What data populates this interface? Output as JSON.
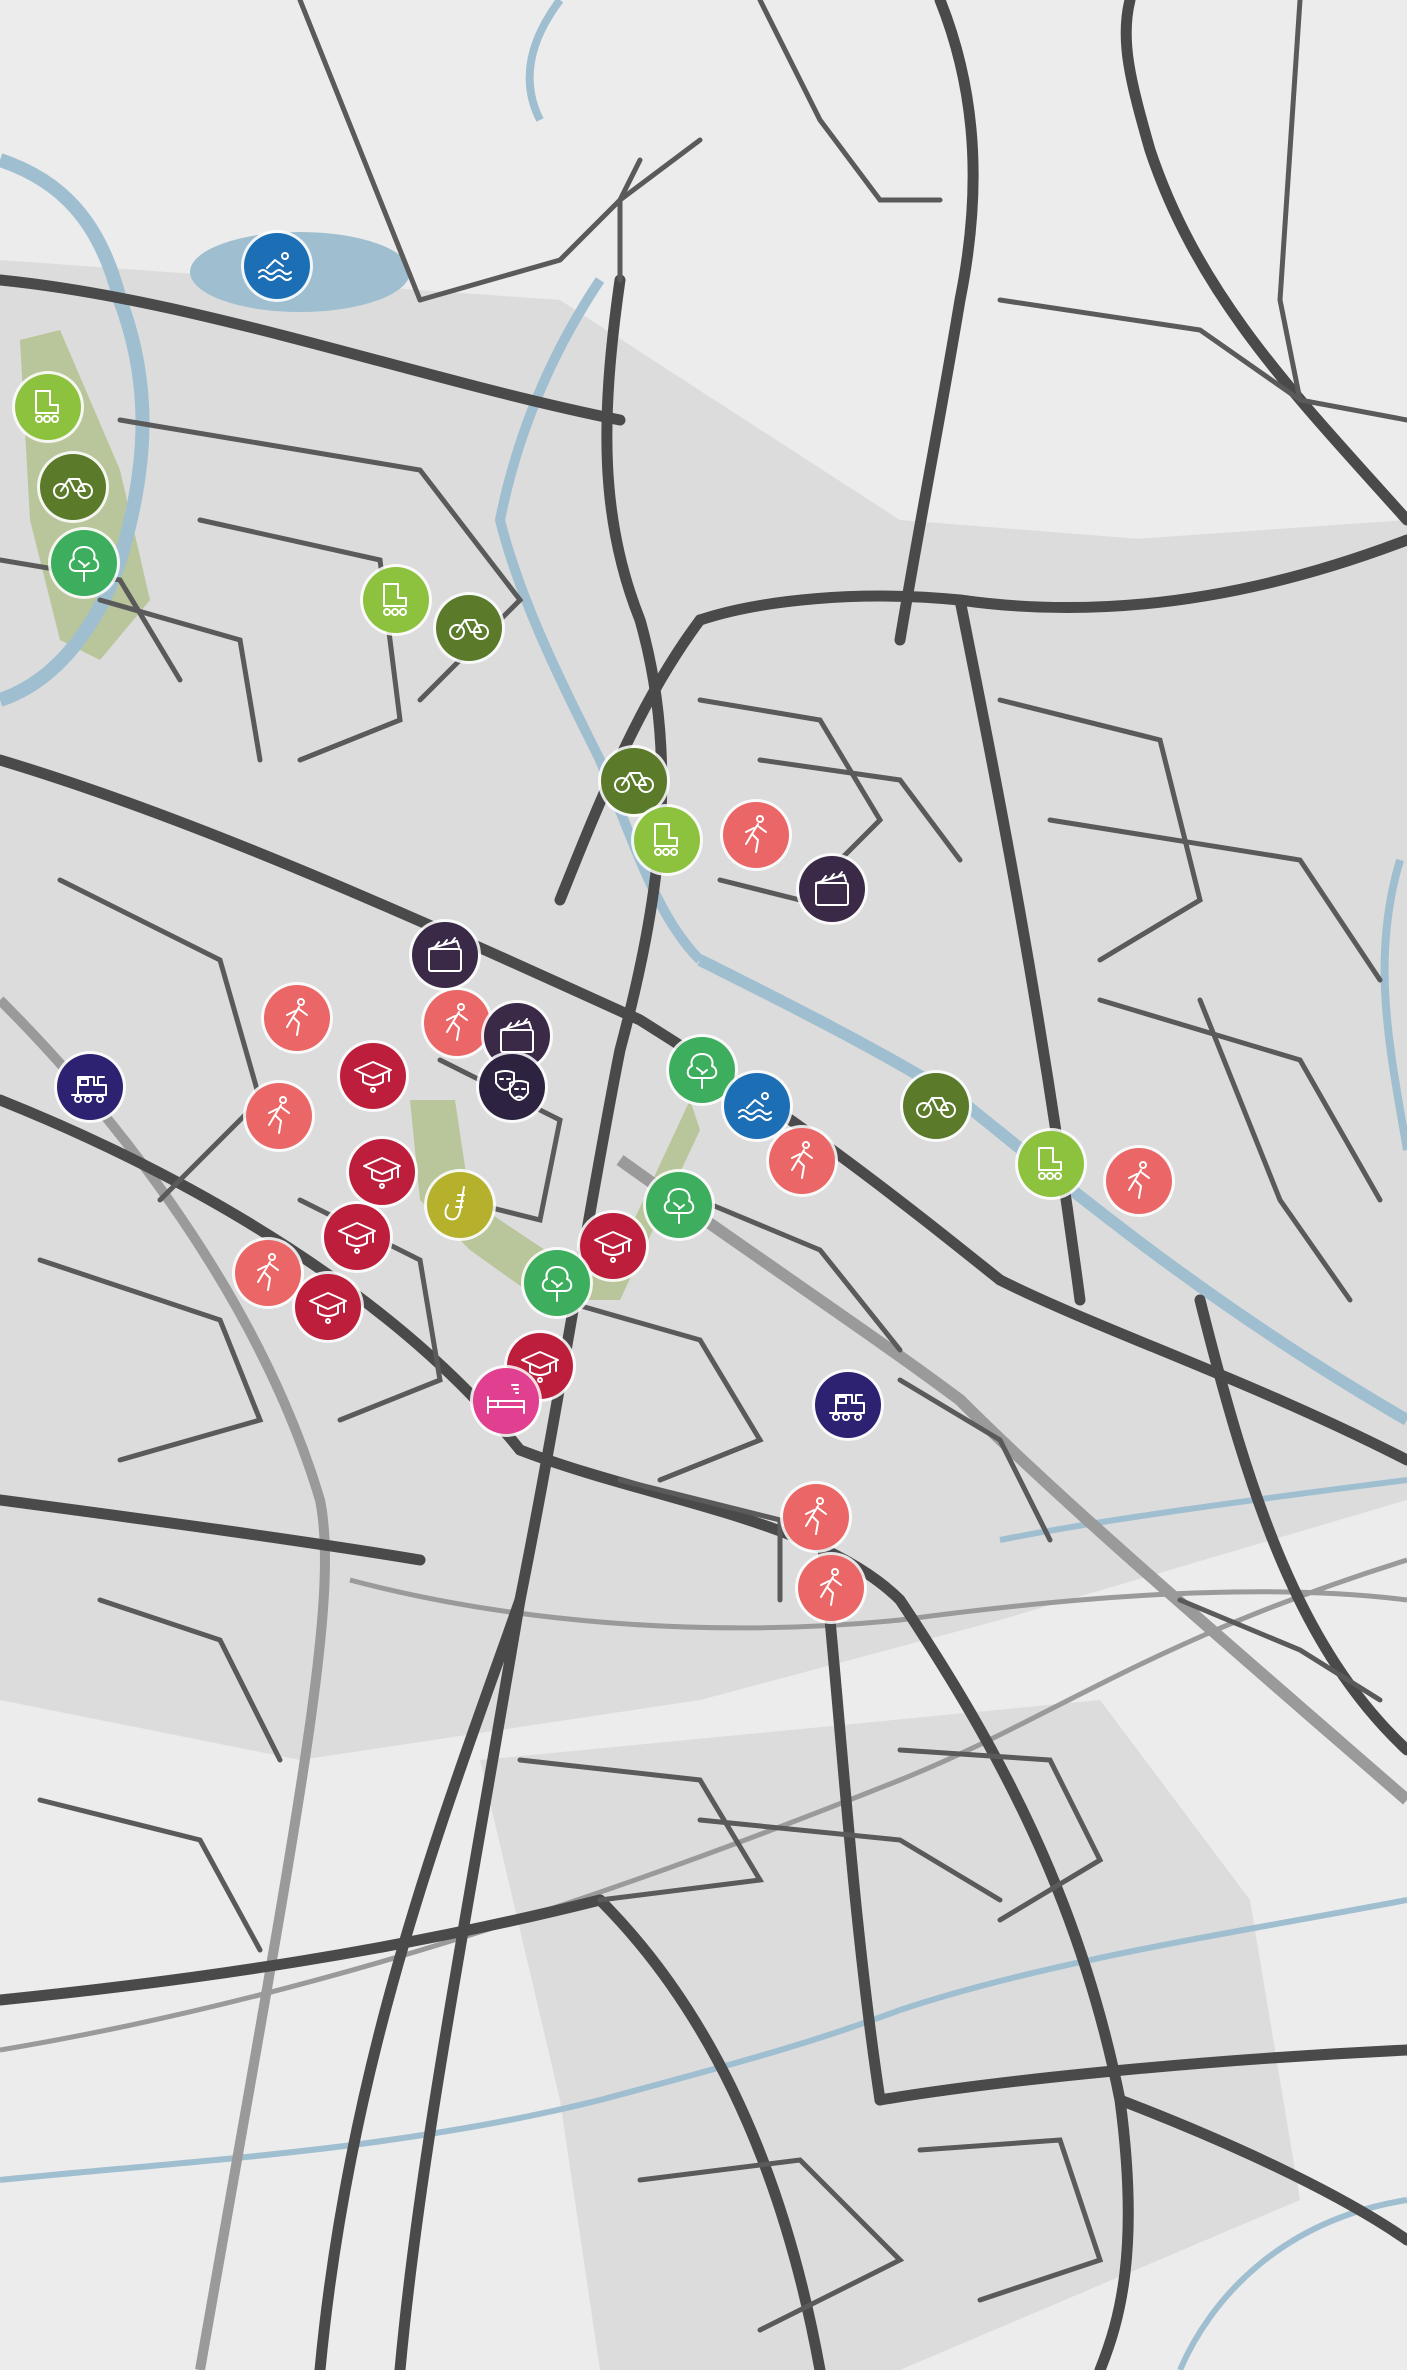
{
  "map": {
    "colors": {
      "background": "#ececec",
      "built_area": "#dcdcdc",
      "road_major": "#4a4a4a",
      "road_minor": "#5a5a5a",
      "railway": "#9a9a9a",
      "water": "#9fbfd1",
      "park": "#b9c59a"
    }
  },
  "categories": {
    "swimming": {
      "color": "#1d6fb5",
      "icon": "swimming-icon"
    },
    "inline_skating": {
      "color": "#8dc23f",
      "icon": "inline-skate-icon"
    },
    "cycling": {
      "color": "#5b7a2a",
      "icon": "bicycle-icon"
    },
    "park": {
      "color": "#3dae5d",
      "icon": "tree-icon"
    },
    "running": {
      "color": "#eb6767",
      "icon": "runner-icon"
    },
    "cinema": {
      "color": "#3a2a48",
      "icon": "clapperboard-icon"
    },
    "theatre": {
      "color": "#2d2340",
      "icon": "theatre-masks-icon"
    },
    "university": {
      "color": "#bd1e3c",
      "icon": "graduation-cap-icon"
    },
    "railway_station": {
      "color": "#2d2272",
      "icon": "locomotive-icon"
    },
    "music": {
      "color": "#b6b12d",
      "icon": "saxophone-icon"
    },
    "hotel": {
      "color": "#e0408f",
      "icon": "bed-icon"
    }
  },
  "markers": [
    {
      "category": "swimming"
    },
    {
      "category": "inline_skating"
    },
    {
      "category": "cycling"
    },
    {
      "category": "park"
    },
    {
      "category": "inline_skating"
    },
    {
      "category": "cycling"
    },
    {
      "category": "cycling"
    },
    {
      "category": "inline_skating"
    },
    {
      "category": "running"
    },
    {
      "category": "cinema"
    },
    {
      "category": "cinema"
    },
    {
      "category": "running"
    },
    {
      "category": "cinema"
    },
    {
      "category": "theatre"
    },
    {
      "category": "running"
    },
    {
      "category": "railway_station"
    },
    {
      "category": "university"
    },
    {
      "category": "running"
    },
    {
      "category": "university"
    },
    {
      "category": "music"
    },
    {
      "category": "university"
    },
    {
      "category": "running"
    },
    {
      "category": "university"
    },
    {
      "category": "park"
    },
    {
      "category": "swimming"
    },
    {
      "category": "running"
    },
    {
      "category": "cycling"
    },
    {
      "category": "inline_skating"
    },
    {
      "category": "running"
    },
    {
      "category": "park"
    },
    {
      "category": "university"
    },
    {
      "category": "park"
    },
    {
      "category": "university"
    },
    {
      "category": "hotel"
    },
    {
      "category": "railway_station"
    },
    {
      "category": "running"
    },
    {
      "category": "running"
    }
  ]
}
